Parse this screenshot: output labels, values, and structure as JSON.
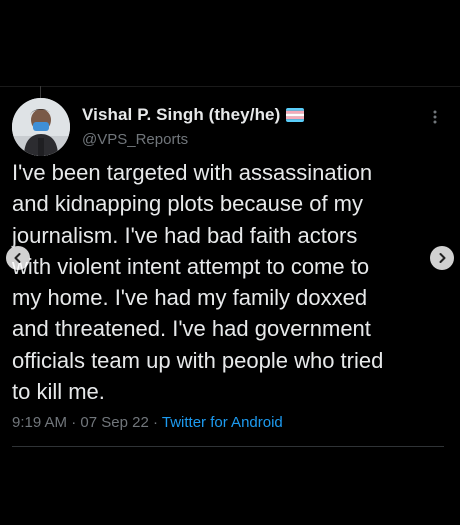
{
  "tweet": {
    "display_name": "Vishal P. Singh (they/he)",
    "handle": "@VPS_Reports",
    "flag_icon": "transgender-flag-icon",
    "body": "I've been targeted with assassination\nand kidnapping plots because of my\njournalism. I've had bad faith actors\nwith violent intent attempt to come to\nmy home. I've had my family doxxed\nand threatened. I've had government\nofficials team up with people who tried\nto kill me.",
    "time": "9:19 AM",
    "separator": "·",
    "date": "07 Sep 22",
    "client": "Twitter for Android"
  },
  "icons": {
    "more": "more-options-icon",
    "prev": "chevron-left-icon",
    "next": "chevron-right-icon"
  },
  "colors": {
    "background": "#000000",
    "text": "#e7e9ea",
    "secondary_text": "#71767b",
    "link": "#1d9bf0",
    "divider": "#2f3336",
    "flag_blue": "#5bcefa",
    "flag_pink": "#f5a9b8",
    "flag_white": "#ffffff"
  }
}
